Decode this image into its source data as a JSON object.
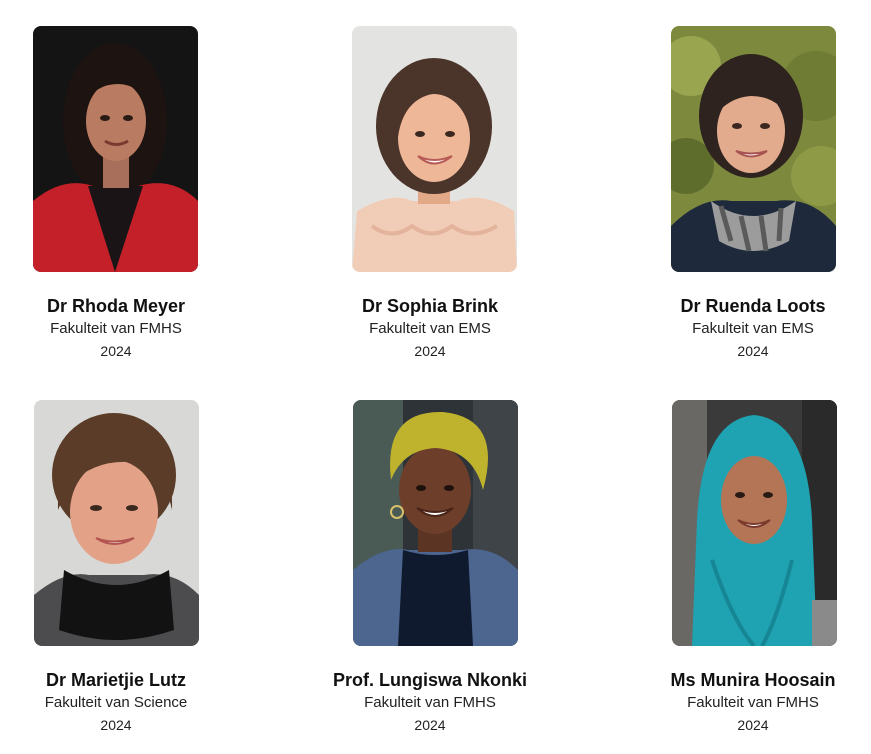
{
  "people": [
    {
      "name": "Dr Rhoda Meyer",
      "faculty": "Fakulteit van FMHS",
      "year": "2024"
    },
    {
      "name": "Dr Sophia Brink",
      "faculty": "Fakulteit van EMS",
      "year": "2024"
    },
    {
      "name": "Dr Ruenda Loots",
      "faculty": "Fakulteit van EMS",
      "year": "2024"
    },
    {
      "name": "Dr Marietjie Lutz",
      "faculty": "Fakulteit van Science",
      "year": "2024"
    },
    {
      "name": "Prof. Lungiswa Nkonki",
      "faculty": "Fakulteit van FMHS",
      "year": "2024"
    },
    {
      "name": "Ms Munira Hoosain",
      "faculty": "Fakulteit van FMHS",
      "year": "2024"
    }
  ],
  "colors": {
    "name_text": "#111111",
    "detail_text": "#222222",
    "background": "#ffffff"
  }
}
